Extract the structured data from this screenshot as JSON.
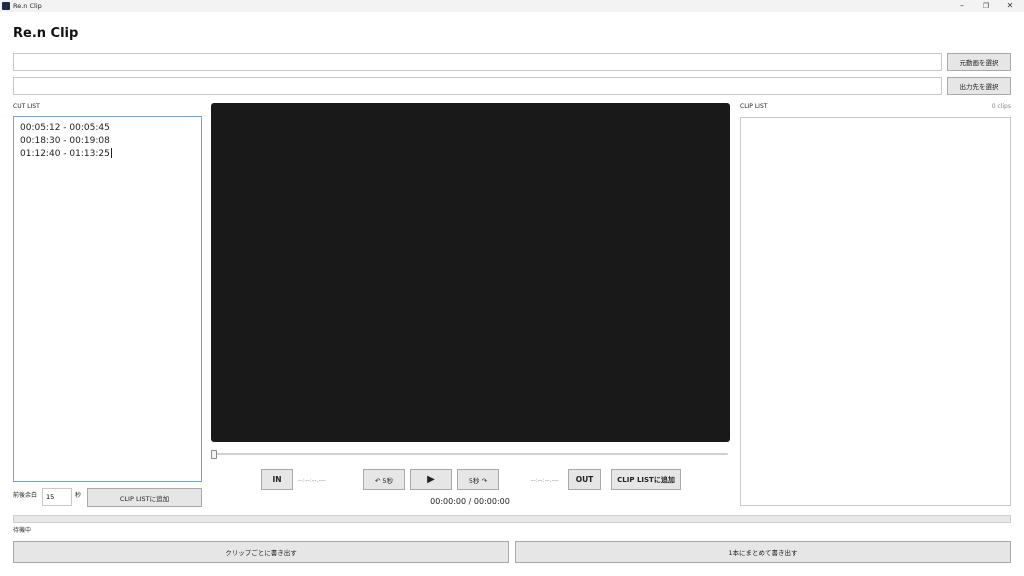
{
  "window": {
    "title": "Re.n Clip",
    "controls": [
      "–",
      "❐",
      "✕"
    ]
  },
  "app": {
    "heading": "Re.n Clip"
  },
  "source": {
    "value": "",
    "button_label": "元動画を選択"
  },
  "output": {
    "value": "",
    "button_label": "出力先を選択"
  },
  "cut_list": {
    "label": "CUT LIST",
    "lines": [
      "00:05:12 - 00:05:45",
      "00:18:30 - 00:19:08",
      "01:12:40 - 01:13:25"
    ]
  },
  "clip_list": {
    "label": "CLIP LIST",
    "count": "0 clips"
  },
  "player": {
    "in_label": "IN",
    "in_time": "--:--:--.---",
    "back_label": "↶ 5秒",
    "play_icon": "▶",
    "fwd_label": "5秒 ↷",
    "out_time": "--:--:--.---",
    "out_label": "OUT",
    "add_label": "CLIP LISTに追加",
    "timecode": "00:00:00 / 00:00:00",
    "seek_position": 0
  },
  "margin": {
    "label": "前後余白",
    "value": "15",
    "unit": "秒",
    "add_label": "CLIP LISTに追加"
  },
  "progress": {
    "value": 0
  },
  "status": {
    "text": "待機中"
  },
  "actions": {
    "per_clip_label": "クリップごとに書き出す",
    "combined_label": "1本にまとめて書き出す"
  },
  "colors": {
    "video_bg": "#191919",
    "cut_list_border": "#6aa7d8"
  }
}
